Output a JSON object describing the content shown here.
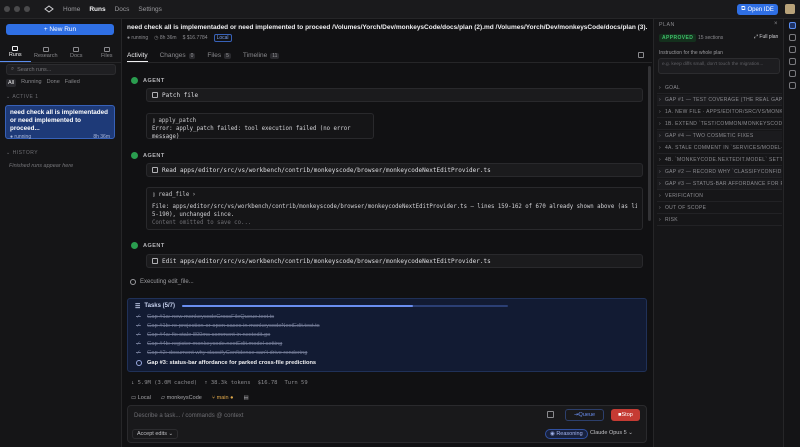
{
  "topbar": {
    "nav": [
      "Home",
      "Runs",
      "Docs",
      "Settings"
    ],
    "active": "Runs",
    "open_ide": "Open IDE"
  },
  "sidebar": {
    "new_run": "+ New Run",
    "tabs": [
      "Runs",
      "Research",
      "Docs",
      "Files"
    ],
    "search_placeholder": "Search runs...",
    "filters": [
      "All",
      "Running",
      "Done",
      "Failed"
    ],
    "active_label": "ACTIVE",
    "active_count": "1",
    "run": {
      "title": "need check all is implementaded or need implemented to proceed...",
      "status": "running",
      "elapsed": "8h 36m"
    },
    "history_label": "HISTORY",
    "history_empty": "Finished runs appear here"
  },
  "header": {
    "title": "need check all is implementaded or need implemented to proceed /Volumes/Yorch/Dev/monkeysCode/docs/plan (2).md /Volumes/Yorch/Dev/monkeysCode/docs/plan (3)...",
    "status": "running",
    "elapsed": "8h 36m",
    "cost": "$16.7784",
    "badge": "Local"
  },
  "tabs": [
    {
      "label": "Activity",
      "count": ""
    },
    {
      "label": "Changes",
      "count": "0"
    },
    {
      "label": "Files",
      "count": "5"
    },
    {
      "label": "Timeline",
      "count": "11"
    }
  ],
  "activity": {
    "agent_label": "AGENT",
    "item1": {
      "tool": "Patch file",
      "call": "apply_patch",
      "output": "Error: apply_patch failed: tool execution failed (no error message)"
    },
    "item2": {
      "tool": "Read apps/editor/src/vs/workbench/contrib/monkeyscode/browser/monkeycodeNextEditProvider.ts",
      "call": "read_file",
      "out1": "File: apps/editor/src/vs/workbench/contrib/monkeyscode/browser/monkeycodeNextEditProvider.ts — lines 159-162 of 670 already shown above (as lines 15",
      "out2": "5-190), unchanged since.",
      "out3": "Content omitted to save co..."
    },
    "item3": {
      "tool": "Edit apps/editor/src/vs/workbench/contrib/monkeyscode/browser/monkeycodeNextEditProvider.ts"
    },
    "executing": "Executing edit_file..."
  },
  "tasks": {
    "title": "Tasks (5/7)",
    "progress": 0.71,
    "items": [
      {
        "label": "Gap #1a: new monkeycodeCrossFileQueue.test.ts",
        "done": true
      },
      {
        "label": "Gap #1b: re-projection-or-open cases in monkeycodeNextEdit.test.ts",
        "done": true
      },
      {
        "label": "Gap #4a: fix stale 800ms comment in nextedit.go",
        "done": true
      },
      {
        "label": "Gap #4b: register monkeycode.nextEdit.model setting",
        "done": true
      },
      {
        "label": "Gap #2: document why classifyConfidence can't drive rendering",
        "done": true
      },
      {
        "label": "Gap #3: status-bar affordance for parked cross-file predictions",
        "done": false
      }
    ]
  },
  "stats": {
    "tokens_in": "↓ 5.9M (3.0M cached)",
    "tokens_out": "↑ 38.3k tokens",
    "cost": "$16.78",
    "turn": "Turn 59"
  },
  "context": {
    "env": "Local",
    "repo": "monkeysCode",
    "branch": "main"
  },
  "composer": {
    "placeholder": "Describe a task...  / commands  @ context",
    "queue": "Queue",
    "stop": "Stop",
    "accept": "Accept edits",
    "reasoning": "Reasoning",
    "model": "Claude Opus 5"
  },
  "plan": {
    "title": "PLAN",
    "status": "APPROVED",
    "sections_count": "15 sections",
    "full_plan": "Full plan",
    "instruction_label": "Instruction for the whole plan",
    "instruction_placeholder": "e.g. keep diffs small, don't touch the migration...",
    "sections": [
      "GOAL",
      "GAP #1 — TEST COVERAGE (THE REAL GAP)",
      "1A. NEW FILE · APPS/EDITOR/SRC/VS/MONKE...",
      "1B. EXTEND `TEST/COMMON/MONKEYSCODE...",
      "GAP #4 — TWO COSMETIC FIXES",
      "4A. STALE COMMENT IN `SERVICES/MODEL-...",
      "4B. `MONKEYCODE.NEXTEDIT.MODEL` SETTI...",
      "GAP #2 — RECORD WHY `CLASSIFYCONFIDEN...",
      "GAP #3 — STATUS-BAR AFFORDANCE FOR P...",
      "VERIFICATION",
      "OUT OF SCOPE",
      "RISK"
    ]
  }
}
